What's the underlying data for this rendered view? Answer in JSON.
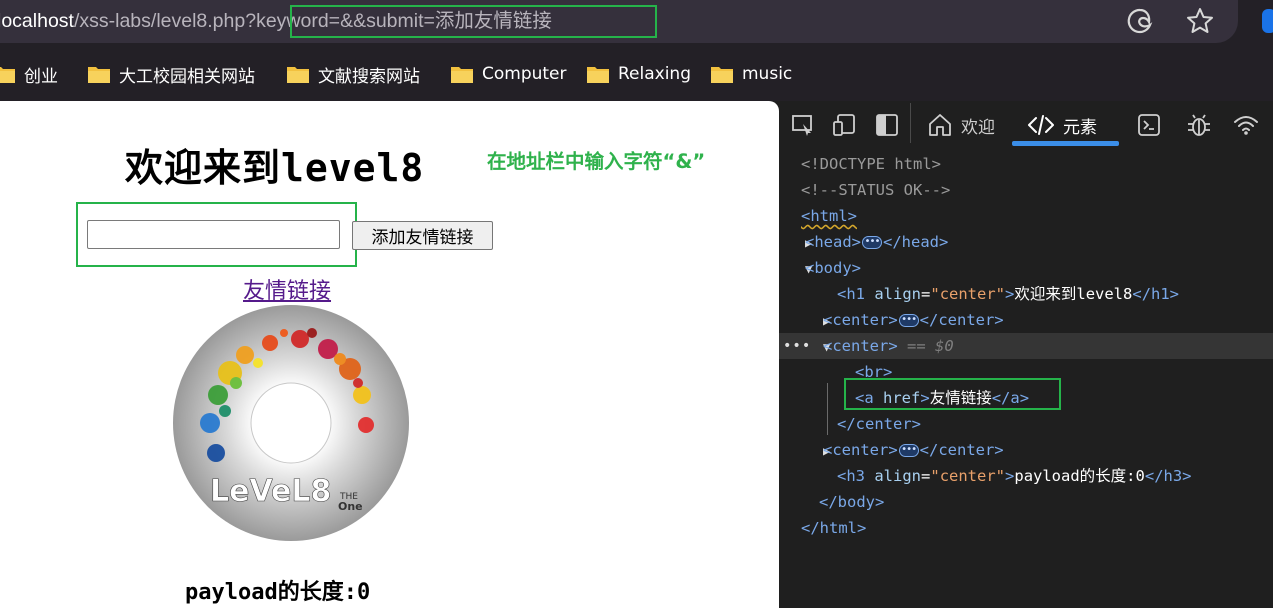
{
  "address_bar": {
    "host": "localhost",
    "path": "/xss-labs/level8.php?keyword=&&submit=添加友情链接"
  },
  "toolbar_icons": [
    "edge-copilot-icon",
    "favorite-star-icon"
  ],
  "bookmarks": [
    {
      "label": "创业",
      "icon": "folder-icon"
    },
    {
      "label": "大工校园相关网站",
      "icon": "folder-icon"
    },
    {
      "label": "文献搜索网站",
      "icon": "folder-icon"
    },
    {
      "label": "Computer",
      "icon": "folder-icon"
    },
    {
      "label": "Relaxing",
      "icon": "folder-icon"
    },
    {
      "label": "music",
      "icon": "folder-icon"
    }
  ],
  "page": {
    "title": "欢迎来到level8",
    "annotation": "在地址栏中输入字符“&”",
    "input_value": "",
    "submit_label": "添加友情链接",
    "link_text": "友情链接",
    "image_alt": "LeVeL8",
    "payload_length": "payload的长度:0"
  },
  "devtools": {
    "tabs": {
      "welcome": "欢迎",
      "elements": "元素"
    },
    "dom": {
      "l1": "<!DOCTYPE html>",
      "l2": "<!--STATUS OK-->",
      "html_open": "<html>",
      "head_open": "<head>",
      "head_close": "</head>",
      "body_open": "<body>",
      "h1_open": "<h1",
      "h1_attr": "align",
      "h1_val": "\"center\"",
      "h1_text": "欢迎来到level8",
      "h1_close": "</h1>",
      "center_open": "<center>",
      "center_close": "</center>",
      "selected_marker": "== $0",
      "br": "<br>",
      "a_open": "<a",
      "a_attr": "href",
      "a_text": "友情链接",
      "a_close": "</a>",
      "h3_open": "<h3",
      "h3_attr": "align",
      "h3_val": "\"center\"",
      "h3_text": "payload的长度:0",
      "h3_close": "</h3>",
      "body_close": "</body>",
      "html_close": "</html>"
    }
  },
  "colors": {
    "highlight_green": "#25b34a",
    "annotation_green": "#2fb24c",
    "devtools_bg": "#1f1f1f",
    "tab_underline": "#3b8ee8"
  }
}
